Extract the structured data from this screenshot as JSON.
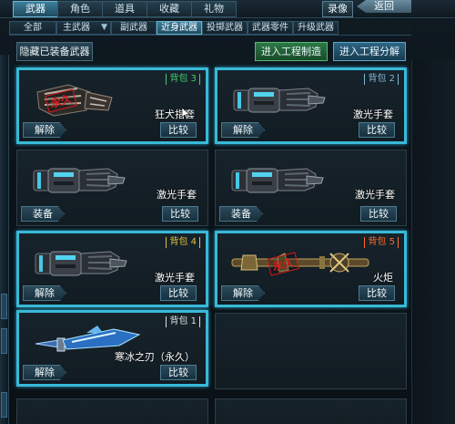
{
  "top_tabs": [
    "武器",
    "角色",
    "道具",
    "收藏",
    "礼物"
  ],
  "top_tab_active": 0,
  "record_label": "录像",
  "back_label": "返回",
  "sub_tabs": [
    "全部",
    "主武器",
    "副武器",
    "近身武器",
    "投掷武器",
    "武器零件",
    "升级武器"
  ],
  "sub_tab_active": 3,
  "hide_equipped_label": "隐藏已装备武器",
  "craft_label": "进入工程制造",
  "decompose_label": "进入工程分解",
  "stamp_text": "永久",
  "colors": {
    "highlight_border": "#39b9d8",
    "bag_green": "#3fd06a",
    "bag_blue": "#7fb6d8",
    "bag_yellow": "#e0c040",
    "bag_orange": "#ff6a2a",
    "bag_white": "#e0e0e0",
    "stamp_red": "#d41c1c"
  },
  "cards": [
    {
      "highlighted": true,
      "bag": "背包 3",
      "bag_color": "green",
      "name": "狂犬指套",
      "left_button": "解除",
      "compare": "比较",
      "weapon": "claw-glove",
      "stamped": true
    },
    {
      "highlighted": true,
      "bag": "背包 2",
      "bag_color": "blue",
      "name": "激光手套",
      "left_button": "解除",
      "compare": "比较",
      "weapon": "laser-glove",
      "stamped": false
    },
    {
      "highlighted": false,
      "bag": "",
      "bag_color": "none",
      "name": "激光手套",
      "left_button": "装备",
      "compare": "比较",
      "weapon": "laser-glove",
      "stamped": false
    },
    {
      "highlighted": false,
      "bag": "",
      "bag_color": "none",
      "name": "激光手套",
      "left_button": "装备",
      "compare": "比较",
      "weapon": "laser-glove",
      "stamped": false
    },
    {
      "highlighted": true,
      "bag": "背包 4",
      "bag_color": "yellow",
      "name": "激光手套",
      "left_button": "解除",
      "compare": "比较",
      "weapon": "laser-glove",
      "stamped": false
    },
    {
      "highlighted": true,
      "bag": "背包 5",
      "bag_color": "orange",
      "name": "火炬",
      "left_button": "解除",
      "compare": "比较",
      "weapon": "torch",
      "stamped": true
    },
    {
      "highlighted": true,
      "bag": "背包 1",
      "bag_color": "white",
      "name": "寒冰之刃（永久）",
      "left_button": "解除",
      "compare": "比较",
      "weapon": "ice-blade",
      "stamped": false
    }
  ]
}
